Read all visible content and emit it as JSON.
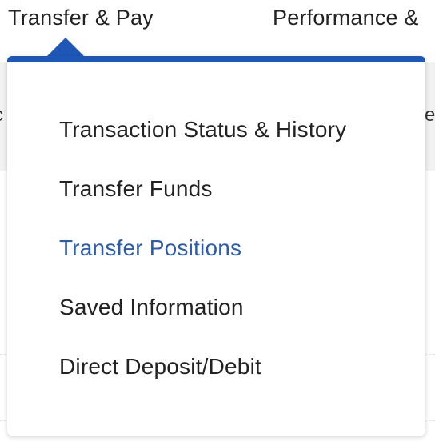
{
  "topnav": {
    "items": [
      {
        "label": "Transfer & Pay",
        "expanded": true
      },
      {
        "label": "Performance &"
      }
    ]
  },
  "background": {
    "left_fragment": "c",
    "right_fragment": "e"
  },
  "dropdown": {
    "accent_color": "#1f57b6",
    "items": [
      {
        "label": "Transaction Status & History"
      },
      {
        "label": "Transfer Funds"
      },
      {
        "label": "Transfer Positions",
        "highlighted": true,
        "color": "#2a5db0"
      },
      {
        "label": "Saved Information"
      },
      {
        "label": "Direct Deposit/Debit"
      }
    ]
  }
}
